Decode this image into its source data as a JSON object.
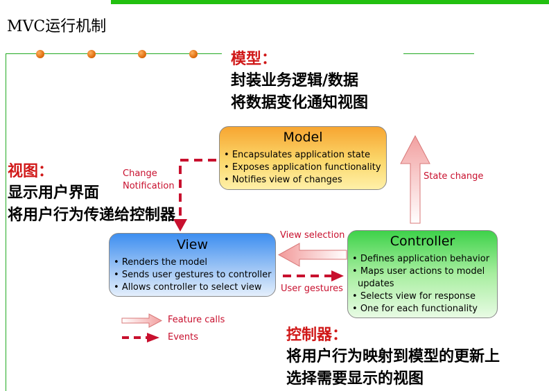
{
  "title": "MVC运行机制",
  "model": {
    "title": "Model",
    "items": [
      "Encapsulates application state",
      "Exposes application functionality",
      "Notifies view of changes"
    ]
  },
  "view": {
    "title": "View",
    "items": [
      "Renders the model",
      "Sends user gestures to controller",
      "Allows controller to select view"
    ]
  },
  "controller": {
    "title": "Controller",
    "items": [
      "Defines application behavior",
      "Maps user actions to model updates",
      "Selects view for response",
      "One for each functionality"
    ]
  },
  "labels": {
    "change_notification_1": "Change",
    "change_notification_2": "Notification",
    "state_change": "State change",
    "view_selection": "View selection",
    "user_gestures": "User gestures"
  },
  "legend": {
    "feature_calls": "Feature calls",
    "events": "Events"
  },
  "notes": {
    "model_head": "模型：",
    "model_line1": "封装业务逻辑/数据",
    "model_line2": "将数据变化通知视图",
    "view_head": "视图：",
    "view_line1": "显示用户界面",
    "view_line2": "将用户行为传递给控制器",
    "controller_head": "控制器：",
    "controller_line1": "将用户行为映射到模型的更新上",
    "controller_line2": "选择需要显示的视图"
  },
  "colors": {
    "accent_green": "#22c010",
    "red": "#c8102e",
    "model_fill": "#f6c050",
    "view_fill": "#7fb0ee",
    "controller_fill": "#9ee88e"
  }
}
